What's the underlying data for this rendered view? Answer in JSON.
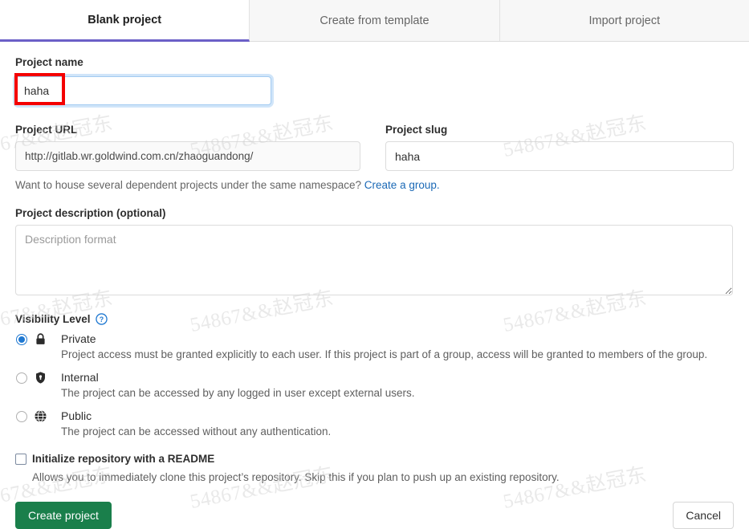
{
  "tabs": [
    {
      "label": "Blank project",
      "active": true
    },
    {
      "label": "Create from template",
      "active": false
    },
    {
      "label": "Import project",
      "active": false
    }
  ],
  "project_name": {
    "label": "Project name",
    "value": "haha",
    "placeholder": ""
  },
  "project_url": {
    "label": "Project URL",
    "value": "http://gitlab.wr.goldwind.com.cn/zhaoguandong/"
  },
  "project_slug": {
    "label": "Project slug",
    "value": "haha",
    "placeholder": ""
  },
  "namespace_helper": {
    "text": "Want to house several dependent projects under the same namespace?",
    "link_label": "Create a group."
  },
  "description": {
    "label": "Project description (optional)",
    "value": "",
    "placeholder": "Description format"
  },
  "visibility": {
    "title": "Visibility Level",
    "help_icon": "question-circle-icon",
    "options": [
      {
        "name": "Private",
        "icon": "lock-icon",
        "selected": true,
        "description": "Project access must be granted explicitly to each user. If this project is part of a group, access will be granted to members of the group."
      },
      {
        "name": "Internal",
        "icon": "shield-icon",
        "selected": false,
        "description": "The project can be accessed by any logged in user except external users."
      },
      {
        "name": "Public",
        "icon": "globe-icon",
        "selected": false,
        "description": "The project can be accessed without any authentication."
      }
    ]
  },
  "readme": {
    "label": "Initialize repository with a README",
    "checked": false,
    "description": "Allows you to immediately clone this project’s repository. Skip this if you plan to push up an existing repository."
  },
  "footer": {
    "create_label": "Create project",
    "cancel_label": "Cancel"
  },
  "colors": {
    "active_tab_underline": "#6b5fc7",
    "primary_button": "#1a7f4b",
    "link": "#1b69b6",
    "radio_selected": "#1f78d1",
    "annotation_box": "#f40000"
  },
  "watermark": {
    "text": "54867&&赵冠东"
  }
}
